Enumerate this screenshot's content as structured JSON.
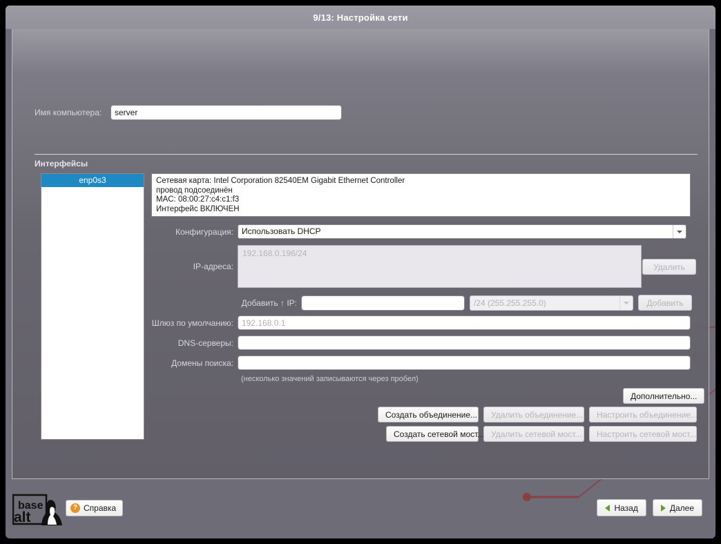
{
  "window": {
    "title": "9/13: Настройка сети"
  },
  "hostname": {
    "label": "Имя компьютера:",
    "value": "server"
  },
  "interfaces_section": {
    "title": "Интерфейсы",
    "items": [
      {
        "name": "enp0s3",
        "selected": true
      }
    ]
  },
  "interface_info": {
    "line1": "Сетевая карта: Intel Corporation 82540EM Gigabit Ethernet Controller",
    "line2": "провод подсоединён",
    "line3": "MAC: 08:00:27:c4:c1:f3",
    "line4": "Интерфейс ВКЛЮЧЕН"
  },
  "config": {
    "label": "Конфигурация:",
    "selected": "Использовать DHCP"
  },
  "ip_addresses": {
    "label": "IP-адреса:",
    "entries": [
      "192.168.0.196/24"
    ],
    "delete_button": "Удалить"
  },
  "add_ip": {
    "label": "Добавить ↑ IP:",
    "value": "",
    "placeholder": "",
    "netmask": "/24 (255.255.255.0)",
    "add_button": "Добавить"
  },
  "gateway": {
    "label": "Шлюз по умолчанию:",
    "value": "",
    "placeholder": "192.168.0.1"
  },
  "dns": {
    "label": "DNS-серверы:",
    "value": "",
    "placeholder": ""
  },
  "domains": {
    "label": "Домены поиска:",
    "value": "",
    "placeholder": ""
  },
  "hint": "(несколько значений записываются через пробел)",
  "actions": {
    "advanced": "Дополнительно...",
    "bond_create": "Создать объединение...",
    "bond_delete": "Удалить объединение...",
    "bond_config": "Настроить объединение...",
    "bridge_create": "Создать сетевой мост...",
    "bridge_delete": "Удалить сетевой мост...",
    "bridge_config": "Настроить сетевой мост..."
  },
  "footer": {
    "logo_line1": "base",
    "logo_line2": "alt",
    "help": "Справка",
    "help_icon": "question-mark",
    "back": "Назад",
    "next": "Далее"
  },
  "colors": {
    "accent_selection": "#1f89c4",
    "background": "#6e6c76",
    "titlebar": "#9a98a2",
    "help_icon": "#e8922a",
    "nav_arrow": "#6c9a2f",
    "decor_line": "#8e3a3f"
  }
}
